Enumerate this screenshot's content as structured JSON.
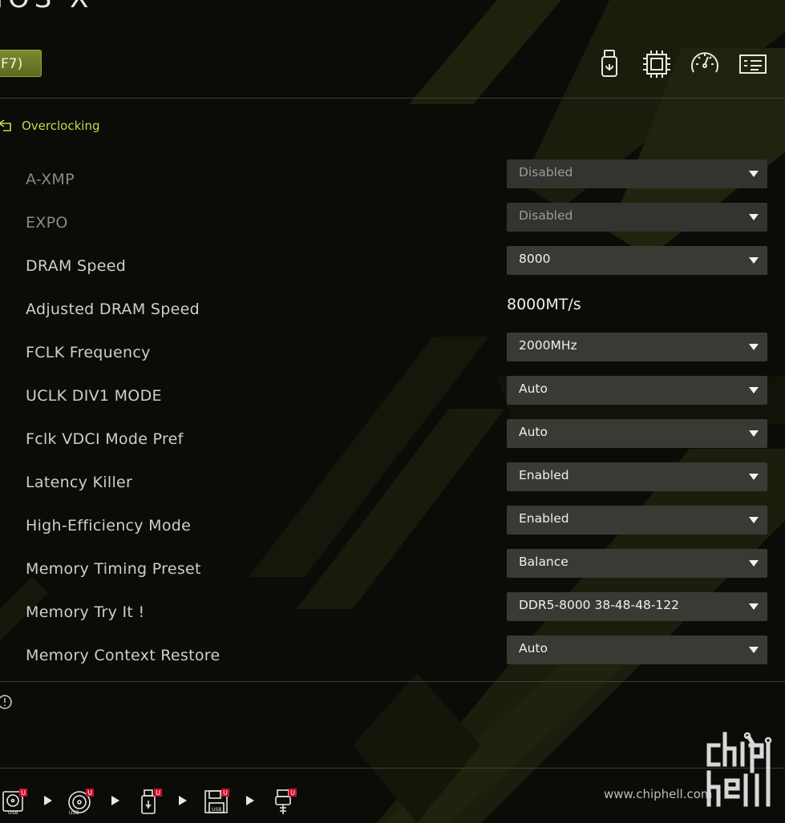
{
  "header": {
    "title_fragment": "IOS X",
    "ez_button_label": "F7)",
    "icons": [
      "usb-flash-icon",
      "cpu-chip-icon",
      "speedometer-icon",
      "id-card-icon"
    ]
  },
  "breadcrumb": {
    "label": "Overclocking",
    "icon": "back-arrow-icon"
  },
  "settings": [
    {
      "label": "A-XMP",
      "type": "select",
      "value": "Disabled",
      "disabled": true
    },
    {
      "label": "EXPO",
      "type": "select",
      "value": "Disabled",
      "disabled": true
    },
    {
      "label": "DRAM Speed",
      "type": "select",
      "value": "8000",
      "disabled": false
    },
    {
      "label": "Adjusted DRAM Speed",
      "type": "readout",
      "value": "8000MT/s",
      "disabled": false
    },
    {
      "label": "FCLK Frequency",
      "type": "select",
      "value": "2000MHz",
      "disabled": false
    },
    {
      "label": "UCLK DIV1 MODE",
      "type": "select",
      "value": "Auto",
      "disabled": false
    },
    {
      "label": "Fclk VDCI Mode Pref",
      "type": "select",
      "value": "Auto",
      "disabled": false
    },
    {
      "label": "Latency Killer",
      "type": "select",
      "value": "Enabled",
      "disabled": false
    },
    {
      "label": "High-Efficiency Mode",
      "type": "select",
      "value": "Enabled",
      "disabled": false
    },
    {
      "label": "Memory Timing Preset",
      "type": "select",
      "value": "Balance",
      "disabled": false
    },
    {
      "label": "Memory Try It !",
      "type": "select",
      "value": "DDR5-8000 38-48-48-122",
      "disabled": false
    },
    {
      "label": "Memory Context Restore",
      "type": "select",
      "value": "Auto",
      "disabled": false
    }
  ],
  "footer": {
    "info_icon": "info-circle-icon",
    "boot_devices": [
      "usb-hdd-icon",
      "usb-cd-icon",
      "usb-flash-drive-icon",
      "usb-floppy-icon",
      "usb-key-icon"
    ],
    "boot_badge": "U",
    "usb_label": "USB",
    "watermark": "www.chiphell.com",
    "logo_text": "chip hell"
  },
  "colors": {
    "accent": "#c9d84a",
    "button_green": "#6e7a26",
    "select_bg": "#3a3a35",
    "background": "#0b0b08"
  }
}
